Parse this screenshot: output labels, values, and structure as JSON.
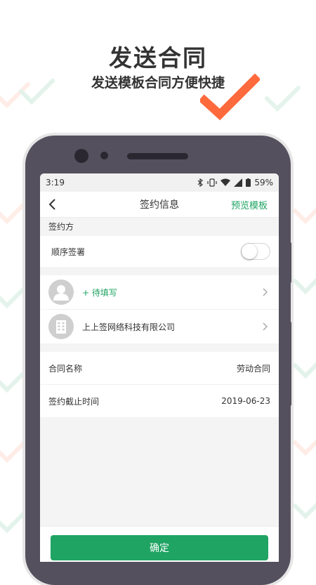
{
  "promo": {
    "headline": "发送合同",
    "subline": "发送模板合同方便快捷"
  },
  "status_bar": {
    "time": "3:19",
    "battery": "59%"
  },
  "nav": {
    "title": "签约信息",
    "preview": "预览模板"
  },
  "signers": {
    "section_label": "签约方",
    "sequential_label": "顺序签署",
    "sequential_on": false,
    "parties": [
      {
        "name": "+ 待填写",
        "icon": "person-icon",
        "pending": true
      },
      {
        "name": "上上签网络科技有限公司",
        "icon": "building-icon",
        "pending": false
      }
    ]
  },
  "contract": {
    "name_label": "合同名称",
    "name_value": "劳动合同",
    "deadline_label": "签约截止时间",
    "deadline_value": "2019-06-23"
  },
  "footer": {
    "confirm": "确定"
  },
  "colors": {
    "accent": "#1fa463",
    "check": "#ff6a3d",
    "phone_body": "#55505e"
  }
}
